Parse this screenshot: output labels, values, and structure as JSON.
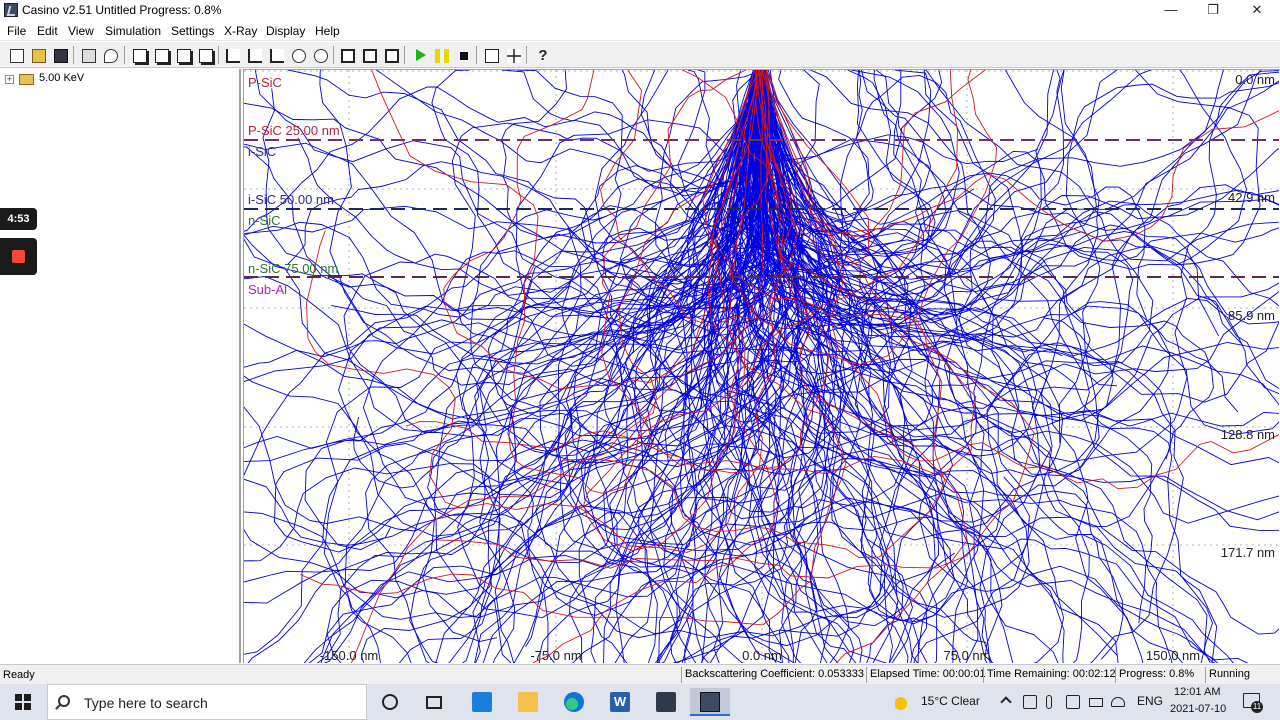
{
  "window": {
    "title": "Casino v2.51 Untitled Progress: 0.8%",
    "minimize_glyph": "—",
    "restore_glyph": "❐",
    "close_glyph": "✕"
  },
  "menu": [
    "File",
    "Edit",
    "View",
    "Simulation",
    "Settings",
    "X-Ray",
    "Display",
    "Help"
  ],
  "toolbar": {
    "icons": [
      "new-icon",
      "open-icon",
      "save-icon",
      "print-icon",
      "print-preview-icon",
      "copy-icon",
      "copy-all-icon",
      "paste-icon",
      "refresh-icon",
      "graph-icon",
      "graph-settings-icon",
      "histogram-icon",
      "circle-icon",
      "target-icon",
      "display-icon",
      "display-2d-icon",
      "display-3d-icon",
      "run-icon",
      "pause-icon",
      "stop-icon",
      "zoom-fit-icon",
      "move-icon",
      "help-icon"
    ],
    "help_glyph": "?"
  },
  "tree": {
    "expander": "+",
    "root_label": "5.00 KeV"
  },
  "recorder": {
    "timer": "4:53"
  },
  "plot": {
    "layer_labels": [
      {
        "text": "P-SiC",
        "color": "#b0243c"
      },
      {
        "text": "P-SiC 25.00 nm",
        "color": "#b0243c"
      },
      {
        "text": "i-SiC",
        "color": "#2a2a9a"
      },
      {
        "text": "i-SiC 50.00 nm",
        "color": "#2a2a9a"
      },
      {
        "text": "n-SiC",
        "color": "#2a7a2a"
      },
      {
        "text": "n-SiC 75.00 nm",
        "color": "#2a7a2a"
      },
      {
        "text": "Sub-Al",
        "color": "#b020a8"
      }
    ],
    "boundary_colors": [
      "#7a2a6a",
      "#1c2a5a",
      "#5a2a4a"
    ],
    "depth_labels": [
      "0.0 nm",
      "42.9 nm",
      "85.9 nm",
      "128.8 nm",
      "171.7 nm"
    ],
    "x_labels": [
      "-150.0 nm",
      "-75.0 nm",
      "0.0 nm",
      "75.0 nm",
      "150.0 nm"
    ],
    "trajectory_colors": {
      "transmitted": "#0000e0",
      "backscattered": "#d01818"
    }
  },
  "status": {
    "ready": "Ready",
    "backscatter": "Backscattering Coefficient: 0.053333",
    "elapsed": "Elapsed Time: 00:00:01",
    "remaining": "Time Remaining: 00:02:12",
    "progress": "Progress: 0.8%",
    "state": "Running"
  },
  "taskbar": {
    "search_placeholder": "Type here to search",
    "apps": [
      "cortana-icon",
      "task-view-icon",
      "mail-icon",
      "file-explorer-icon",
      "edge-icon",
      "word-icon",
      "store-icon",
      "casino-icon"
    ],
    "word_glyph": "W",
    "weather": "15°C  Clear",
    "language": "ENG",
    "time": "12:01 AM",
    "date": "2021-07-10",
    "notifications": "11"
  }
}
